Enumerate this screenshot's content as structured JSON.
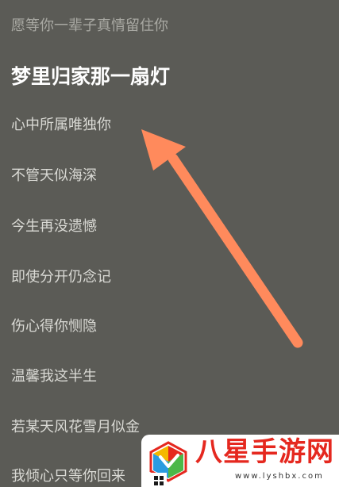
{
  "lyrics": {
    "lines": [
      "愿等你一辈子真情留住你",
      "梦里归家那一扇灯",
      "心中所属唯独你",
      "不管天似海深",
      "今生再没遗憾",
      "即使分开仍念记",
      "伤心得你恻隐",
      "温馨我这半生",
      "若某天风花雪月似金",
      "我倾心只等你回来"
    ],
    "current_index": 1
  },
  "annotation": {
    "arrow_color": "#ff8a5c"
  },
  "watermark": {
    "brand": "八星手游网",
    "url": "www.lyshbx.com",
    "brand_color": "#e5281f"
  },
  "taskbar": {
    "icon": "windows-start-icon"
  }
}
